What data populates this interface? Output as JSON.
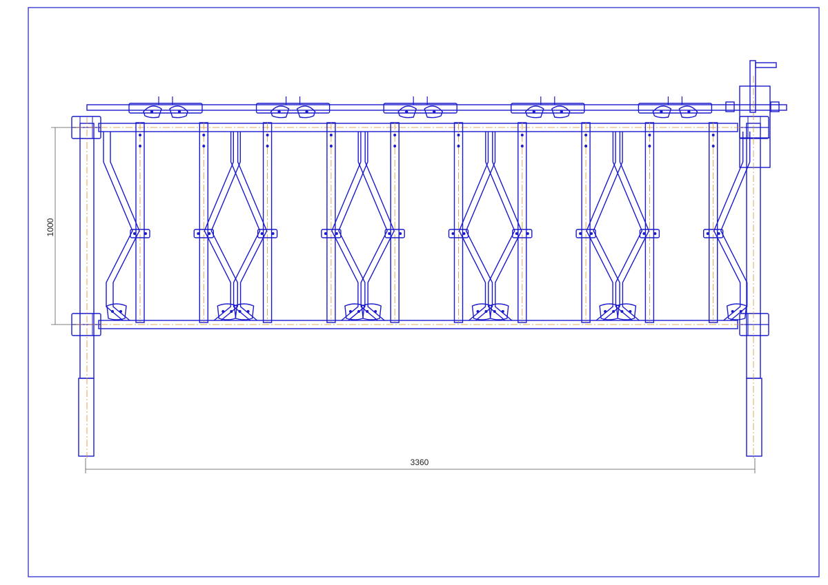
{
  "drawing": {
    "line_color": "#1a1acc",
    "axis_color": "#d89030",
    "dim_color": "#555555",
    "background": "#ffffff",
    "section_count": 10,
    "dimensions": {
      "height_label": "1000",
      "width_label": "3360"
    }
  }
}
